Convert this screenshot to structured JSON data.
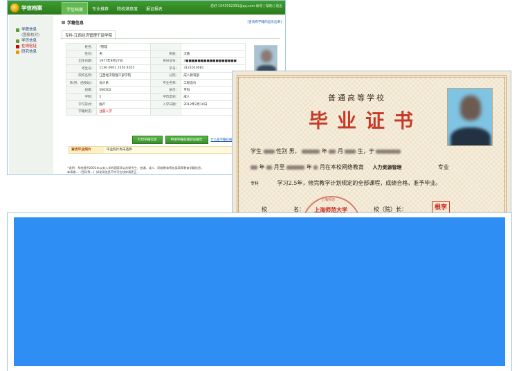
{
  "web": {
    "logo_text": "学信档案",
    "nav_tabs": [
      "学信档案",
      "专业推荐",
      "院校满意度",
      "报证报名"
    ],
    "user_links": "您好 1043502391@qq.com  帐号 | 帮助 | 退出",
    "sidebar": [
      {
        "label": "学籍信息",
        "style": "normal"
      },
      {
        "label": "(图像校对)",
        "style": "sub"
      },
      {
        "label": "学历信息",
        "style": "normal"
      },
      {
        "label": "在线验证",
        "style": "red"
      },
      {
        "label": "研究信息",
        "style": "orange"
      }
    ],
    "section_title": "学籍信息",
    "show_all": "[查询有学籍的显示出来]",
    "school_tab": "专科-江西经济管理干部学院",
    "fields": [
      [
        "姓名：",
        "?管理",
        "",
        ""
      ],
      [
        "性别：",
        "男",
        "民族：",
        "汉族"
      ],
      [
        "出生日期：",
        "1977年9月27日",
        "身份证号：",
        "3■■■■■■■■■■■■■■■■■"
      ],
      [
        "考生号：",
        "1136 0001 1550 4025",
        "学号：",
        "3121010081"
      ],
      [
        "院校名称：",
        "江西经济管理干部学院",
        "分院：",
        "成人教育部"
      ],
      [
        "系(所、函授站)：",
        "会计系",
        "专业名称：",
        "工程造价"
      ],
      [
        "班级：",
        "560502",
        "层次：",
        "专科"
      ],
      [
        "学制：",
        "2",
        "学历类别：",
        "成人"
      ],
      [
        "学习形式：",
        "脱产",
        "入学日期：",
        "2012年2月10日"
      ],
      [
        "学籍状态：",
        "注册入学",
        "",
        ""
      ]
    ],
    "buttons": [
      "打印学籍信息",
      "申请学籍在线验证报告",
      "什么是学籍在线验证"
    ],
    "photo_row": {
      "label": "查找毕业照片",
      "value": "毕业照片尚未选择"
    },
    "note": "•说明：系统提供2001年以来入学的国家承认的研究生、普通、成人、网络教育等各类高等教育学籍信息，",
    "note2": "本表格…（密码等…）如发现信息不符可在线申请更正…"
  },
  "cert": {
    "header": "普通高等学校",
    "title": "毕业证书",
    "line1_a": "学生",
    "line1_b": "性别 男，",
    "line1_c": "年",
    "line1_d": "月",
    "line1_e": "生，于",
    "line2_a": "年",
    "line2_b": "月至",
    "line2_c": "年",
    "line2_d": "月在本校网络教育",
    "major": "人力资源管理",
    "line2_e": "专业",
    "level": "专科",
    "line3": "学习2.5年，修完教学计划规定的全部课程，成绩合格，准予毕业。",
    "sign_left": "校",
    "sign_mid": "名：",
    "sign_right": "校（院）长：",
    "seal_text": "上海师范大学",
    "seal_top": "上海师范",
    "stamp_text": "根李"
  },
  "colors": {
    "overlay": "#2f8ef4",
    "green": "#3d8f2e",
    "cert_red": "#c63a2a"
  }
}
